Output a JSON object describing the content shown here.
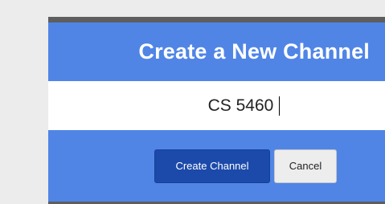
{
  "modal": {
    "title": "Create a New Channel",
    "input": {
      "value": "CS 5460",
      "placeholder": ""
    },
    "buttons": {
      "create_label": "Create Channel",
      "cancel_label": "Cancel"
    }
  },
  "colors": {
    "modal_background": "#5085e6",
    "primary_button": "#1c4aab",
    "secondary_button": "#ededed",
    "page_background": "#ececec"
  }
}
